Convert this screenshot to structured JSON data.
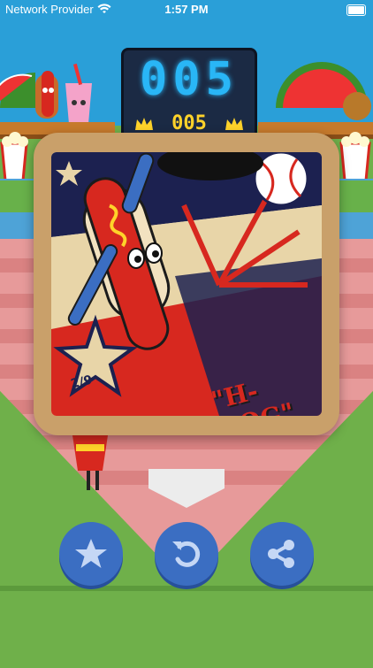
{
  "status_bar": {
    "carrier": "Network Provider",
    "time": "1:57 PM"
  },
  "scoreboard": {
    "score": "005",
    "best_score": "005"
  },
  "card": {
    "collection_progress": "2/9",
    "title": "\"H-DOG\""
  },
  "buttons": [
    "star-button",
    "replay-button",
    "share-button"
  ],
  "colors": {
    "sky": "#2a9fd8",
    "grass": "#6fb04a",
    "button": "#3b6ec2",
    "score_led": "#29b6f6",
    "best_led": "#ffd32a",
    "card_red": "#d7281f",
    "card_navy": "#1c2150"
  }
}
